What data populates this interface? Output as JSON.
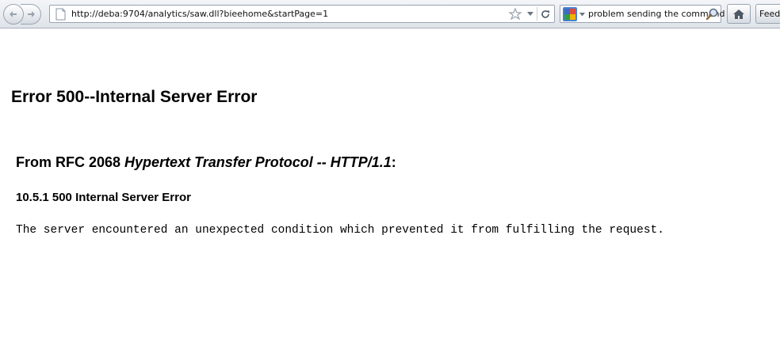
{
  "browser": {
    "url": "http://deba:9704/analytics/saw.dll?bieehome&startPage=1",
    "search_query": "problem sending the command",
    "feed_label": "Feedl",
    "icons": {
      "back": "back-arrow-icon",
      "forward": "forward-arrow-icon",
      "page": "page-icon",
      "bookmark": "star-icon",
      "reload": "reload-icon",
      "search_engine": "google-icon",
      "search": "magnifier-icon",
      "home": "home-icon"
    }
  },
  "page": {
    "title": "Error 500--Internal Server Error",
    "rfc_prefix": "From RFC 2068 ",
    "rfc_title": "Hypertext Transfer Protocol -- HTTP/1.1",
    "rfc_suffix": ":",
    "section": "10.5.1 500 Internal Server Error",
    "message": "The server encountered an unexpected condition which prevented it from fulfilling the request."
  }
}
